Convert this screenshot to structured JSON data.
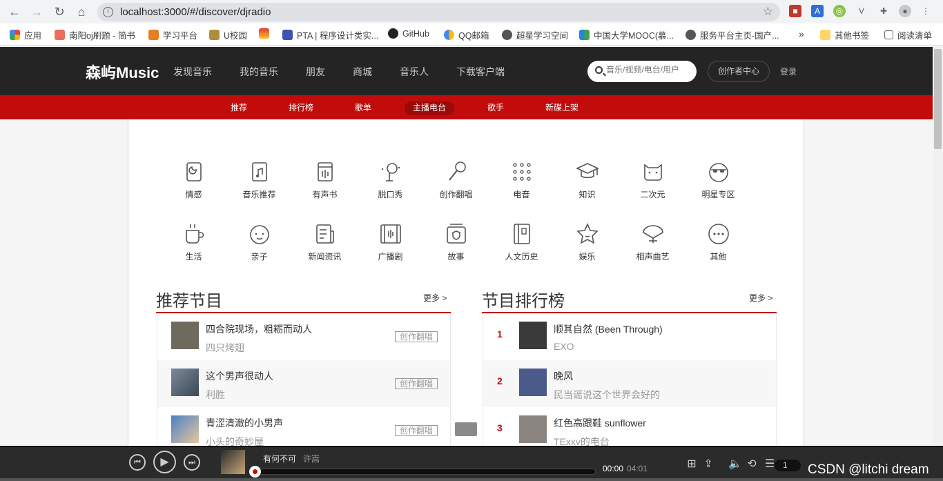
{
  "browser": {
    "url": "localhost:3000/#/discover/djradio",
    "bookmarks": [
      "应用",
      "南阳oj刷题 - 简书",
      "学习平台",
      "U校园",
      "",
      "PTA | 程序设计类实...",
      "GitHub",
      "QQ邮箱",
      "超星学习空间",
      "中国大学MOOC(慕...",
      "服务平台主页-国产..."
    ],
    "overflow": "»",
    "other_bookmarks": "其他书签",
    "reading_list": "阅读清单"
  },
  "site": {
    "logo": "森屿Music",
    "nav": [
      "发现音乐",
      "我的音乐",
      "朋友",
      "商城",
      "音乐人",
      "下载客户端"
    ],
    "search_placeholder": "音乐/视频/电台/用户",
    "creator_center": "创作者中心",
    "login": "登录",
    "subnav": [
      "推荐",
      "排行榜",
      "歌单",
      "主播电台",
      "歌手",
      "新碟上架"
    ],
    "subnav_active": "主播电台"
  },
  "categories": [
    {
      "label": "情感",
      "icon": "emotion-icon"
    },
    {
      "label": "音乐推荐",
      "icon": "music-note-book-icon"
    },
    {
      "label": "有声书",
      "icon": "audiobook-icon"
    },
    {
      "label": "脱口秀",
      "icon": "talkshow-mic-icon"
    },
    {
      "label": "创作翻唱",
      "icon": "microphone-icon"
    },
    {
      "label": "电音",
      "icon": "dots-grid-icon"
    },
    {
      "label": "知识",
      "icon": "graduation-cap-icon"
    },
    {
      "label": "二次元",
      "icon": "cat-face-icon"
    },
    {
      "label": "明星专区",
      "icon": "sunglasses-face-icon"
    },
    {
      "label": "生活",
      "icon": "coffee-cup-icon"
    },
    {
      "label": "亲子",
      "icon": "baby-face-icon"
    },
    {
      "label": "新闻资讯",
      "icon": "newspaper-icon"
    },
    {
      "label": "广播剧",
      "icon": "film-strip-icon"
    },
    {
      "label": "故事",
      "icon": "shield-box-icon"
    },
    {
      "label": "人文历史",
      "icon": "book-icon"
    },
    {
      "label": "娱乐",
      "icon": "star-face-icon"
    },
    {
      "label": "相声曲艺",
      "icon": "fan-icon"
    },
    {
      "label": "其他",
      "icon": "more-circle-icon"
    }
  ],
  "recommend": {
    "title": "推荐节目",
    "more": "更多 >",
    "items": [
      {
        "title": "四合院现场，粗粝而动人",
        "author": "四只烤翅",
        "tag": "创作翻唱",
        "thumb": "#6f6a5e"
      },
      {
        "title": "这个男声很动人",
        "author": "利胜",
        "tag": "创作翻唱",
        "thumb": "#7b8a9c"
      },
      {
        "title": "青涩清澈的小男声",
        "author": "小头的奇妙屋",
        "tag": "创作翻唱",
        "thumb": "#4a7fc4"
      }
    ]
  },
  "ranking": {
    "title": "节目排行榜",
    "more": "更多 >",
    "items": [
      {
        "rank": "1",
        "title": "顺其自然 (Been Through)",
        "author": "EXO",
        "thumb": "#3a3a3a"
      },
      {
        "rank": "2",
        "title": "晚风",
        "author": "民当谣说这个世界会好的",
        "thumb": "#4a5a8a"
      },
      {
        "rank": "3",
        "title": "红色高跟鞋 sunflower",
        "author": "TExxv的电台",
        "thumb": "#8a8480"
      }
    ]
  },
  "player": {
    "song": "有何不可",
    "singer": "许嵩",
    "current": "00:00",
    "duration": "04:01",
    "progress": 0,
    "playlist_count": "1"
  },
  "watermark": "CSDN @litchi dream",
  "colors": {
    "brand_red": "#c20c0c",
    "topbar": "#242424",
    "player": "#2b2b2b"
  }
}
